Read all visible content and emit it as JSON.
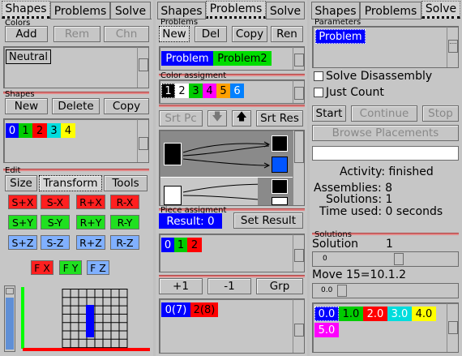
{
  "tabs": [
    "Shapes",
    "Problems",
    "Solve"
  ],
  "left": {
    "colors_label": "Colors",
    "color_buttons": [
      "Add",
      "Rem",
      "Chn"
    ],
    "color_list": [
      "Neutral"
    ],
    "shapes_label": "Shapes",
    "shape_buttons": [
      "New",
      "Delete",
      "Copy"
    ],
    "shape_list": [
      {
        "label": "0",
        "bg": "#0000ff",
        "fg": "#ffffff"
      },
      {
        "label": "1",
        "bg": "#00cc00",
        "fg": "#000000"
      },
      {
        "label": "2",
        "bg": "#ff0000",
        "fg": "#000000"
      },
      {
        "label": "3",
        "bg": "#00dddd",
        "fg": "#000000"
      },
      {
        "label": "4",
        "bg": "#ffff00",
        "fg": "#000000"
      }
    ],
    "edit_label": "Edit",
    "edit_tabs": [
      "Size",
      "Transform",
      "Tools"
    ],
    "transform_rows": [
      [
        {
          "label": "S+X",
          "bg": "#ff2020"
        },
        {
          "label": "S-X",
          "bg": "#ff2020"
        },
        {
          "label": "R+X",
          "bg": "#ff2020"
        },
        {
          "label": "R-X",
          "bg": "#ff2020"
        }
      ],
      [
        {
          "label": "S+Y",
          "bg": "#20e020"
        },
        {
          "label": "S-Y",
          "bg": "#20e020"
        },
        {
          "label": "R+Y",
          "bg": "#20e020"
        },
        {
          "label": "R-Y",
          "bg": "#20e020"
        }
      ],
      [
        {
          "label": "S+Z",
          "bg": "#80b0ff"
        },
        {
          "label": "S-Z",
          "bg": "#80b0ff"
        },
        {
          "label": "R+Z",
          "bg": "#80b0ff"
        },
        {
          "label": "R-Z",
          "bg": "#80b0ff"
        }
      ]
    ],
    "flip_buttons": [
      {
        "label": "F X",
        "bg": "#ff2020"
      },
      {
        "label": "F Y",
        "bg": "#20e020"
      },
      {
        "label": "F Z",
        "bg": "#80b0ff"
      }
    ]
  },
  "middle": {
    "problems_label": "Problems",
    "problem_buttons": [
      "New",
      "Del",
      "Copy",
      "Ren"
    ],
    "problem_list": [
      {
        "label": "Problem",
        "bg": "#0000ff",
        "fg": "#ffffff"
      },
      {
        "label": "Problem2",
        "bg": "#00dd00",
        "fg": "#000000"
      }
    ],
    "color_assign_label": "Color assigment",
    "color_assign_list": [
      {
        "label": "1",
        "bg": "#000000",
        "fg": "#ffffff"
      },
      {
        "label": "2",
        "bg": "#ffffff",
        "fg": "#000000"
      },
      {
        "label": "3",
        "bg": "#00cc00",
        "fg": "#000000"
      },
      {
        "label": "4",
        "bg": "#ff00ff",
        "fg": "#000000"
      },
      {
        "label": "5",
        "bg": "#ffa000",
        "fg": "#000000"
      },
      {
        "label": "6",
        "bg": "#0080ff",
        "fg": "#ffffff"
      }
    ],
    "sort_buttons": [
      "Srt Pc",
      "Srt Res"
    ],
    "piece_assign_label": "Piece assigment",
    "result_label": "Result: 0",
    "set_result_label": "Set Result",
    "piece_list": [
      {
        "label": "0",
        "bg": "#0000ff",
        "fg": "#ffffff"
      },
      {
        "label": "1",
        "bg": "#00cc00",
        "fg": "#000000"
      },
      {
        "label": "2",
        "bg": "#ff0000",
        "fg": "#000000"
      }
    ],
    "count_buttons": [
      "+1",
      "-1",
      "Grp"
    ],
    "count_list": [
      {
        "label": "0(7)",
        "bg": "#0000ff",
        "fg": "#ffffff"
      },
      {
        "label": "2(8)",
        "bg": "#ff0000",
        "fg": "#000000"
      }
    ]
  },
  "right": {
    "params_label": "Parameters",
    "param_list": [
      {
        "label": "Problem",
        "bg": "#0000ff",
        "fg": "#ffffff"
      }
    ],
    "solve_disassembly": "Solve Disassembly",
    "just_count": "Just Count",
    "action_buttons": [
      "Start",
      "Continue",
      "Stop"
    ],
    "browse_label": "Browse Placements",
    "activity": "Activity: finished",
    "assemblies": "Assemblies: 8",
    "solutions": "Solutions: 1",
    "time_used": "Time used: 0 seconds",
    "solutions_label": "Solutions",
    "solution_caption": "Solution",
    "solution_value": "1",
    "solution_slider_min": "0",
    "move_caption": "Move 15=10.1.2",
    "move_slider_min": "0.0",
    "result_chips": [
      {
        "label": "0.0",
        "bg": "#0000ff",
        "fg": "#ffffff"
      },
      {
        "label": "1.0",
        "bg": "#00cc00",
        "fg": "#000000"
      },
      {
        "label": "2.0",
        "bg": "#ff0000",
        "fg": "#ffffff"
      },
      {
        "label": "3.0",
        "bg": "#00dddd",
        "fg": "#ffffff"
      },
      {
        "label": "4.0",
        "bg": "#ffff00",
        "fg": "#000000"
      },
      {
        "label": "5.0",
        "bg": "#ff00ff",
        "fg": "#ffffff"
      }
    ]
  }
}
